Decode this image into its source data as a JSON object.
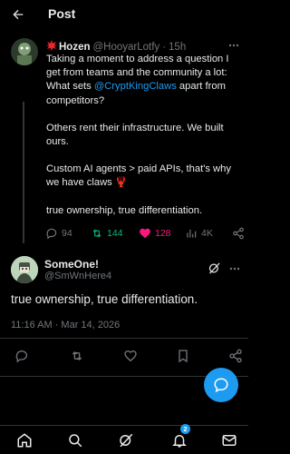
{
  "header": {
    "title": "Post"
  },
  "parent_post": {
    "author_name": "Hozen",
    "author_handle": "@HooyarLotfy",
    "separator": "·",
    "age": "15h",
    "line1": "Taking a moment to address a question I get from teams and the community a lot: What sets ",
    "mention": "@CryptKingClaws",
    "line1_end": " apart from competitors?",
    "para2": "Others rent their infrastructure. We built ours.",
    "para3": "Custom AI agents > paid APIs, that's why we have claws 🦞",
    "para4": "true ownership, true differentiation.",
    "stats": {
      "replies": "94",
      "reposts": "144",
      "likes": "128",
      "views": "4K"
    },
    "colors": {
      "repost": "#00ba7c",
      "like": "#f91880",
      "mention": "#1d9bf0"
    }
  },
  "reply_post": {
    "author_name": "SomeOne!",
    "author_handle": "@SmWnHere4",
    "text": "true ownership, true differentiation.",
    "timestamp": "11:16 AM · Mar 14, 2026"
  },
  "fab": {
    "icon": "chat-bubble-icon"
  },
  "bottom_nav": {
    "items": [
      "home-icon",
      "search-icon",
      "grok-icon",
      "notifications-icon",
      "messages-icon"
    ],
    "notification_count": "2"
  }
}
